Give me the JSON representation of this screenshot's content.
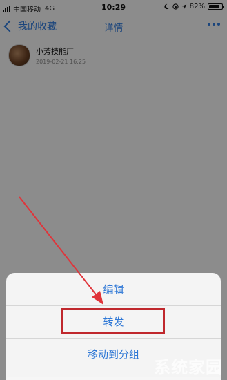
{
  "status_bar": {
    "carrier": "中国移动",
    "network": "4G",
    "time": "10:29",
    "battery": "82%",
    "battery_level": 0.82
  },
  "nav": {
    "back_label": "我的收藏",
    "title": "详情"
  },
  "item": {
    "name": "小芳技能厂",
    "time": "2019-02-21 16:25"
  },
  "action_sheet": {
    "items": [
      "编辑",
      "转发",
      "移动到分组"
    ]
  },
  "annotation": {
    "highlight_color": "#c0282d"
  },
  "watermark": "系统家园",
  "colors": {
    "accent": "#2f78d6"
  }
}
